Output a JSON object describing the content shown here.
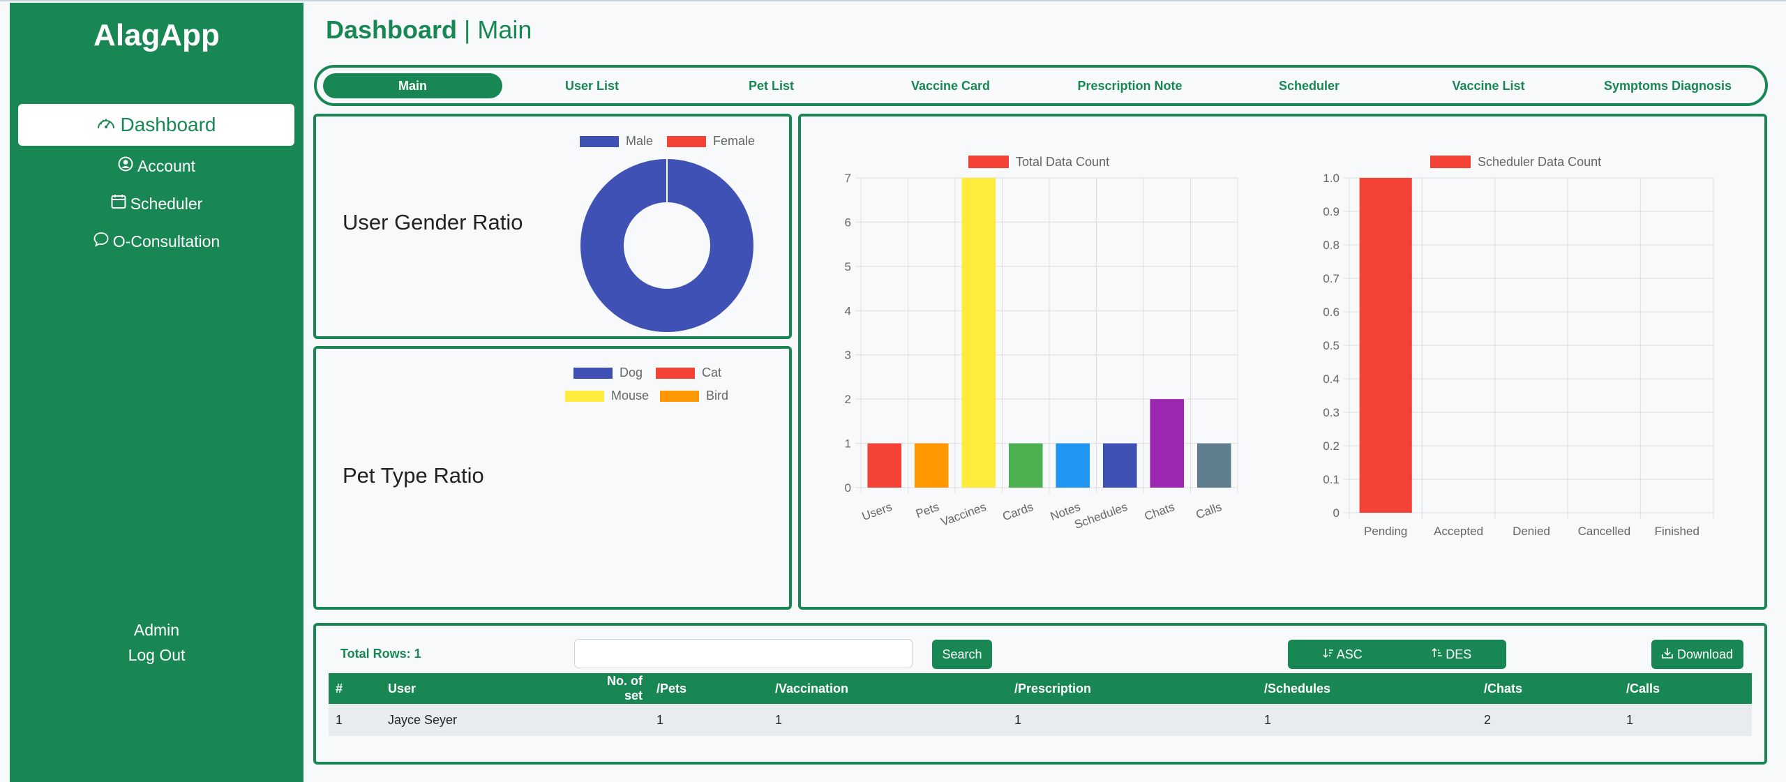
{
  "sidebar": {
    "brand": "AlagApp",
    "items": [
      {
        "label": "Dashboard",
        "icon": "gauge-icon",
        "active": true
      },
      {
        "label": "Account",
        "icon": "user-circle-icon"
      },
      {
        "label": "Scheduler",
        "icon": "calendar-icon"
      },
      {
        "label": "O-Consultation",
        "icon": "chat-bubble-icon"
      }
    ],
    "user": "Admin",
    "logout": "Log Out"
  },
  "header": {
    "title_bold": "Dashboard",
    "title_rest": " | Main"
  },
  "tabs": [
    {
      "label": "Main",
      "active": true
    },
    {
      "label": "User List"
    },
    {
      "label": "Pet List"
    },
    {
      "label": "Vaccine Card"
    },
    {
      "label": "Prescription Note"
    },
    {
      "label": "Scheduler"
    },
    {
      "label": "Vaccine List"
    },
    {
      "label": "Symptoms Diagnosis"
    }
  ],
  "gender_panel": {
    "title": "User Gender Ratio"
  },
  "pet_panel": {
    "title": "Pet Type Ratio"
  },
  "colors": {
    "accent": "#198754",
    "male": "#3f51b5",
    "female": "#f44336",
    "dog": "#3f51b5",
    "cat": "#f44336",
    "mouse": "#ffeb3b",
    "bird": "#ff9800"
  },
  "chart_data": [
    {
      "type": "pie",
      "donut": true,
      "legend": [
        "Male",
        "Female"
      ],
      "values": [
        1,
        0
      ],
      "colors": [
        "#3f51b5",
        "#f44336"
      ]
    },
    {
      "type": "pie",
      "donut": true,
      "legend": [
        "Dog",
        "Cat",
        "Mouse",
        "Bird"
      ],
      "values": [
        0,
        0,
        0,
        0
      ],
      "colors": [
        "#3f51b5",
        "#f44336",
        "#ffeb3b",
        "#ff9800"
      ]
    },
    {
      "type": "bar",
      "series_name": "Total Data Count",
      "legend_color": "#f44336",
      "categories": [
        "Users",
        "Pets",
        "Vaccines",
        "Cards",
        "Notes",
        "Schedules",
        "Chats",
        "Calls"
      ],
      "values": [
        1,
        1,
        7,
        1,
        1,
        1,
        2,
        1
      ],
      "colors": [
        "#f44336",
        "#ff9800",
        "#ffeb3b",
        "#4caf50",
        "#2196f3",
        "#3f51b5",
        "#9c27b0",
        "#607d8b"
      ],
      "ylim": [
        0,
        7
      ],
      "yticks": [
        "0",
        "1",
        "2",
        "3",
        "4",
        "5",
        "6",
        "7"
      ],
      "grid": true,
      "legend_position": "top"
    },
    {
      "type": "bar",
      "series_name": "Scheduler Data Count",
      "legend_color": "#f44336",
      "categories": [
        "Pending",
        "Accepted",
        "Denied",
        "Cancelled",
        "Finished"
      ],
      "values": [
        1,
        0,
        0,
        0,
        0
      ],
      "colors": [
        "#f44336",
        "#f44336",
        "#f44336",
        "#f44336",
        "#f44336"
      ],
      "ylim": [
        0,
        1
      ],
      "yticks": [
        "0",
        "0.1",
        "0.2",
        "0.3",
        "0.4",
        "0.5",
        "0.6",
        "0.7",
        "0.8",
        "0.9",
        "1.0"
      ],
      "grid": true,
      "legend_position": "top"
    }
  ],
  "table_panel": {
    "total_rows": "Total Rows: 1",
    "search_value": "",
    "search_label": "Search",
    "asc_label": "ASC",
    "des_label": "DES",
    "download_label": "Download",
    "headers": [
      "#",
      "User",
      "No. of set",
      "/Pets",
      "/Vaccination",
      "/Prescription",
      "/Schedules",
      "/Chats",
      "/Calls"
    ],
    "rows": [
      [
        "1",
        "Jayce Seyer",
        "",
        "1",
        "1",
        "1",
        "1",
        "2",
        "1"
      ]
    ]
  }
}
